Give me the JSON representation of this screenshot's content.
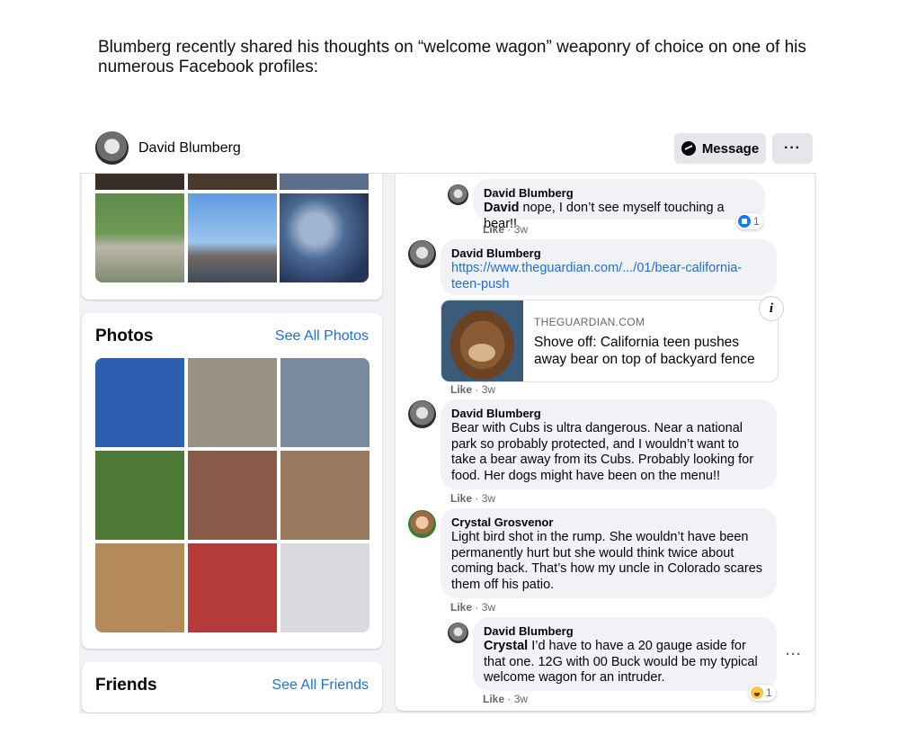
{
  "intro_text": "Blumberg recently shared his thoughts on “welcome wagon” weaponry of choice on one of his numerous Facebook profiles:",
  "profile": {
    "name": "David Blumberg",
    "message_label": "Message",
    "more_label": "···"
  },
  "photos": {
    "title": "Photos",
    "see_all": "See All Photos",
    "tiles": [
      {
        "name": "photo-blue-sports-car",
        "color": "#2c5fb0"
      },
      {
        "name": "photo-man-tshirt",
        "color": "#9a9184"
      },
      {
        "name": "photo-man-israel-sign",
        "color": "#7a8a9e"
      },
      {
        "name": "photo-garden-fence",
        "color": "#4e7a38"
      },
      {
        "name": "photo-framed-art",
        "color": "#8a5a48"
      },
      {
        "name": "photo-city-skyline-sunset",
        "color": "#9a7a5e"
      },
      {
        "name": "photo-trumpet-player",
        "color": "#b48a5a"
      },
      {
        "name": "photo-red-flowers",
        "color": "#b53a3a"
      },
      {
        "name": "photo-social-post",
        "color": "#d8dadf"
      }
    ]
  },
  "friends": {
    "title": "Friends",
    "see_all": "See All Friends"
  },
  "comments": [
    {
      "author": "David Blumberg",
      "bold": "David",
      "text": " nope, I don’t see myself touching a bear!!",
      "like": "Like",
      "time": "3w",
      "reaction_count": "1"
    },
    {
      "author": "David Blumberg",
      "link": "https://www.theguardian.com/.../01/bear-california-teen-push",
      "like": "Like",
      "time": "3w"
    },
    {
      "author": "David Blumberg",
      "text": "Bear with Cubs is ultra dangerous. Near a national park so probably protected, and I wouldn’t want to take a bear away from its Cubs. Probably looking for food. Her dogs might have been on the menu!!",
      "like": "Like",
      "time": "3w"
    },
    {
      "author": "Crystal Grosvenor",
      "text": "Light bird shot in the rump. She wouldn’t have been permanently hurt but she would think twice about coming back. That’s how my uncle in Colorado scares them off his patio.",
      "like": "Like",
      "time": "3w"
    },
    {
      "author": "David Blumberg",
      "bold": "Crystal",
      "text": " I’d have to have a 20 gauge aside for that one. 12G with 00 Buck would be my typical welcome wagon for an intruder.",
      "like": "Like",
      "time": "3w",
      "reaction_count": "1"
    }
  ],
  "link_preview": {
    "domain": "THEGUARDIAN.COM",
    "title": "Shove off: California teen pushes away bear on top of backyard fence",
    "info": "i"
  },
  "more_options": "···"
}
